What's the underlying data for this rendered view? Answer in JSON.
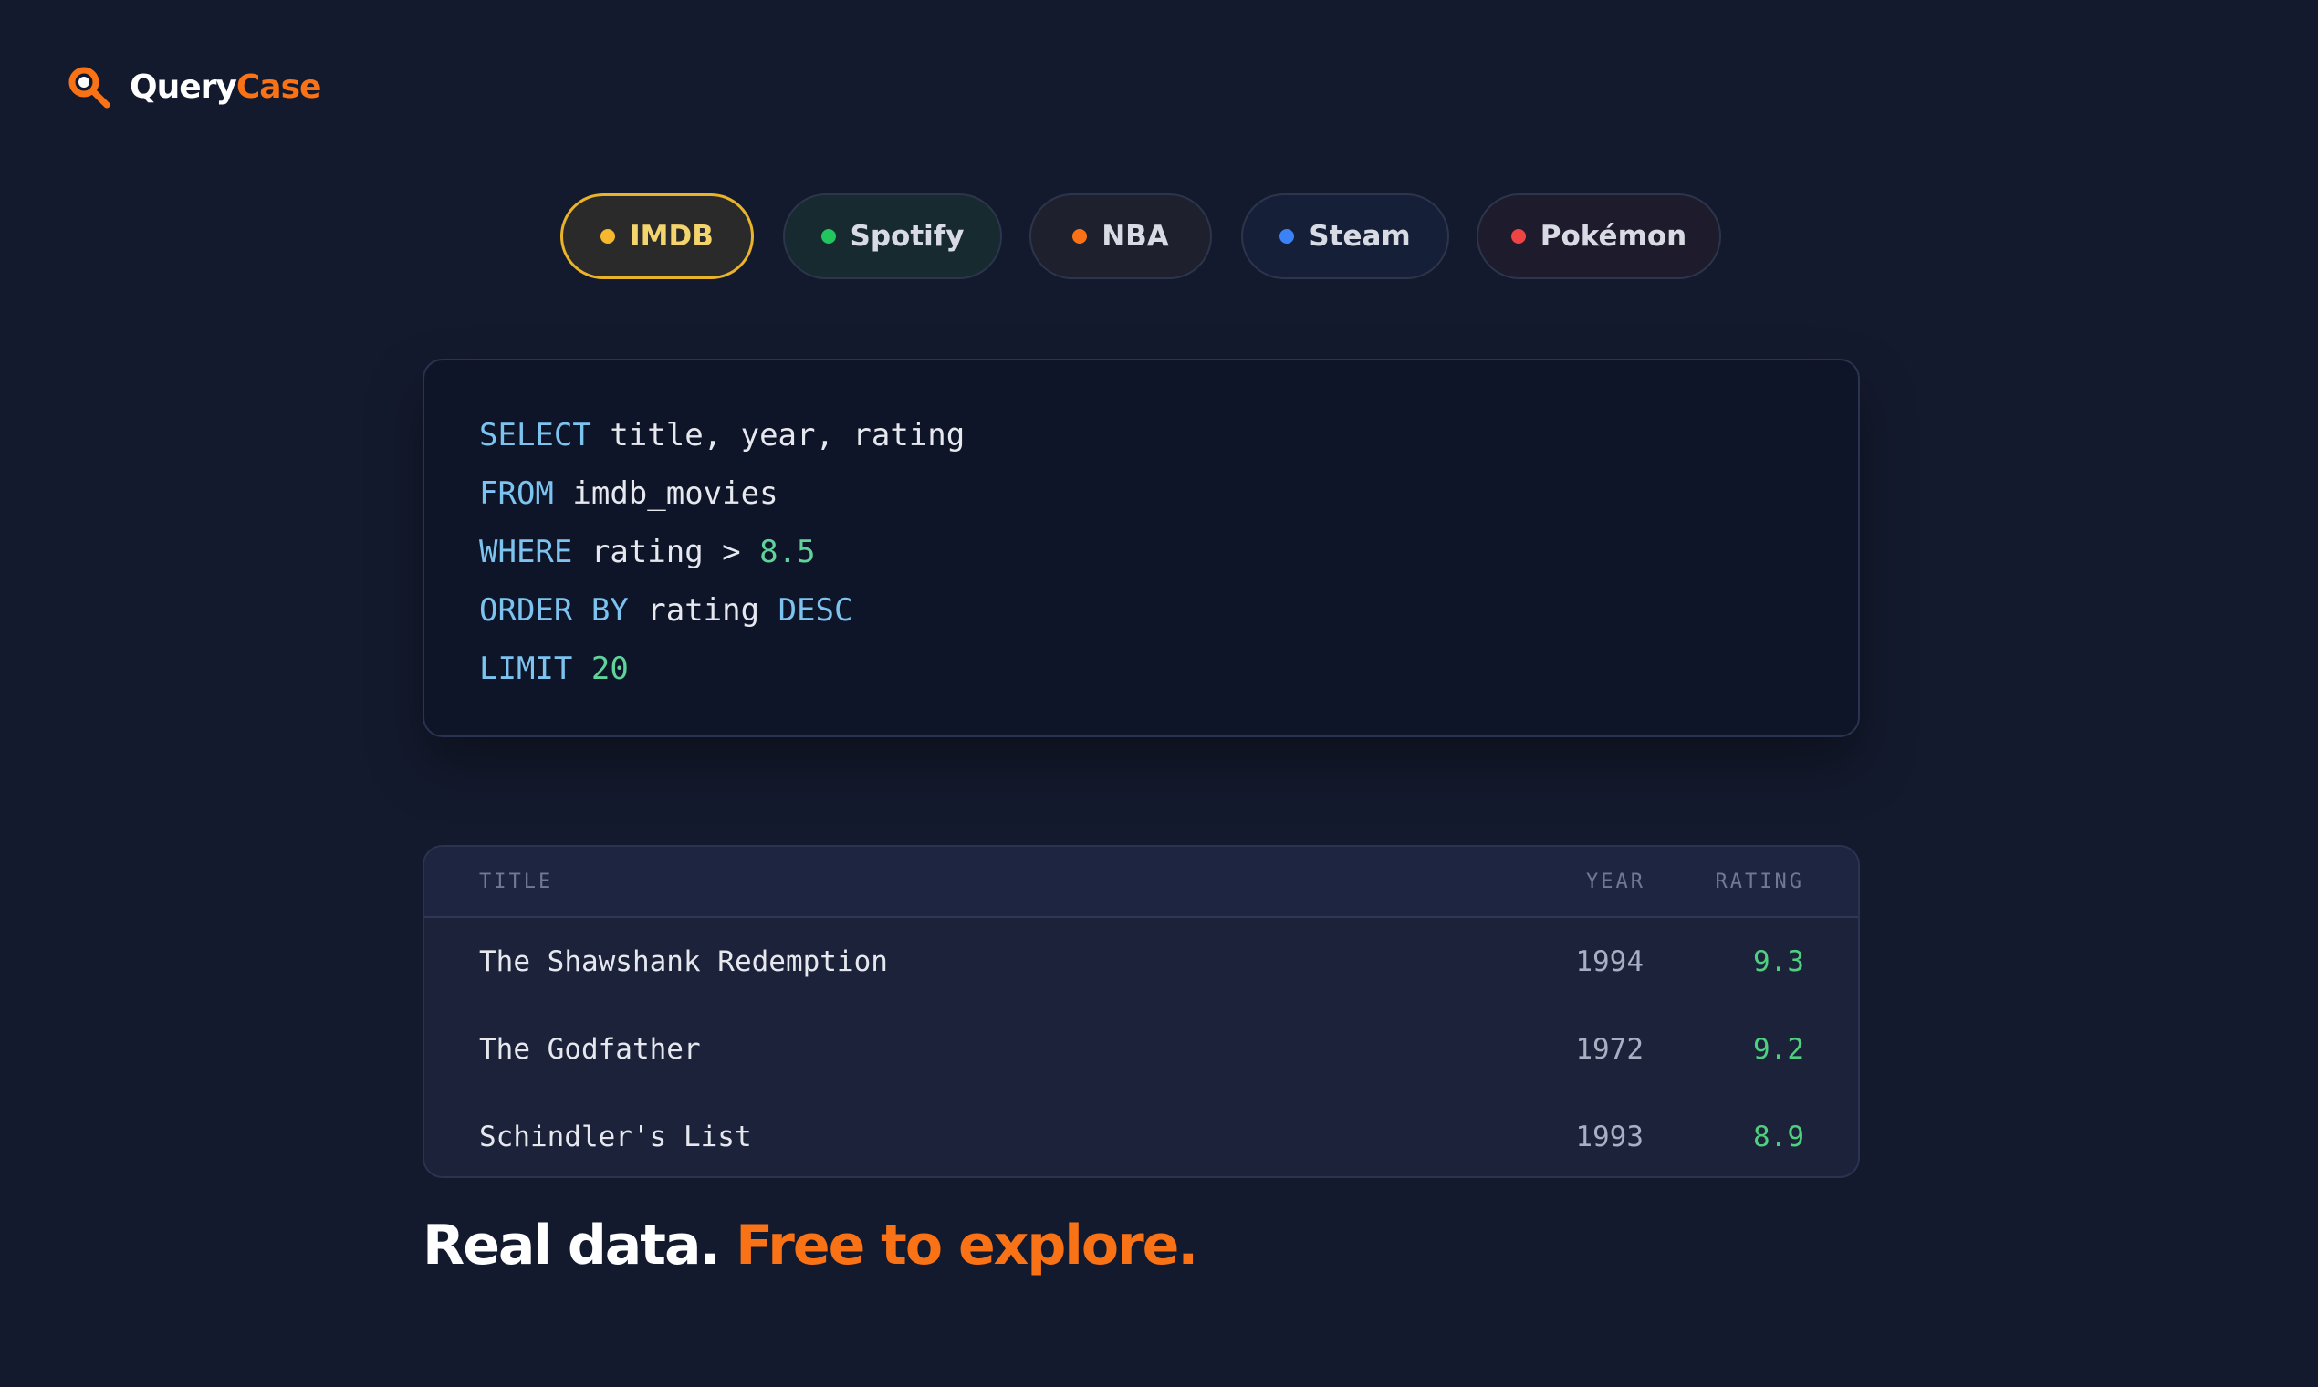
{
  "brand": {
    "name_part1": "Query",
    "name_part2": "Case",
    "accent_color": "#f97316",
    "icon": "magnifier-icon"
  },
  "datasets": [
    {
      "label": "IMDB",
      "dot_color": "#f5b82e",
      "active": true
    },
    {
      "label": "Spotify",
      "dot_color": "#22c55e",
      "active": false
    },
    {
      "label": "NBA",
      "dot_color": "#f97316",
      "active": false
    },
    {
      "label": "Steam",
      "dot_color": "#3b82f6",
      "active": false
    },
    {
      "label": "Pokémon",
      "dot_color": "#ef4444",
      "active": false
    }
  ],
  "query": {
    "line1": {
      "kw1": "SELECT",
      "rest": "title, year, rating"
    },
    "line2": {
      "kw1": "FROM",
      "rest": "imdb_movies"
    },
    "line3": {
      "kw1": "WHERE",
      "rest": "rating >",
      "num": "8.5"
    },
    "line4": {
      "kw1": "ORDER BY",
      "rest": "rating",
      "kw2": "DESC"
    },
    "line5": {
      "kw1": "LIMIT",
      "num": "20"
    }
  },
  "results": {
    "headers": {
      "title": "TITLE",
      "year": "YEAR",
      "rating": "RATING"
    },
    "rows": [
      {
        "title": "The Shawshank Redemption",
        "year": "1994",
        "rating": "9.3"
      },
      {
        "title": "The Godfather",
        "year": "1972",
        "rating": "9.2"
      },
      {
        "title": "Schindler's List",
        "year": "1993",
        "rating": "8.9"
      }
    ]
  },
  "tagline": {
    "part1": "Real data.",
    "part2": "Free to explore."
  }
}
